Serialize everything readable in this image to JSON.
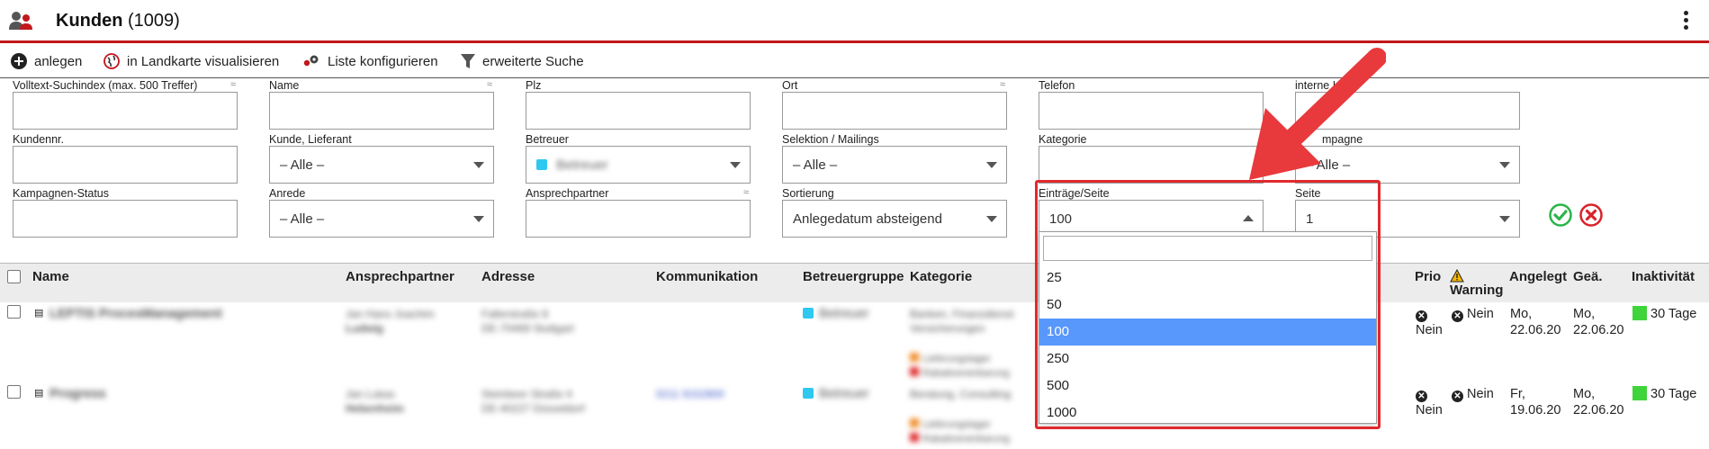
{
  "header": {
    "title": "Kunden",
    "count": "(1009)"
  },
  "toolbar": {
    "add_label": "anlegen",
    "map_label": "in Landkarte visualisieren",
    "config_label": "Liste konfigurieren",
    "search_label": "erweiterte Suche"
  },
  "filters": {
    "fulltext": {
      "label": "Volltext-Suchindex (max. 500 Treffer)",
      "value": ""
    },
    "name": {
      "label": "Name",
      "value": ""
    },
    "plz": {
      "label": "Plz",
      "value": ""
    },
    "ort": {
      "label": "Ort",
      "value": ""
    },
    "telefon": {
      "label": "Telefon",
      "value": ""
    },
    "interne": {
      "label": "interne I",
      "value": ""
    },
    "kundennr": {
      "label": "Kundennr.",
      "value": ""
    },
    "kunde_lieferant": {
      "label": "Kunde, Lieferant",
      "value": "– Alle –"
    },
    "betreuer": {
      "label": "Betreuer",
      "value": "Betreuer"
    },
    "selektion": {
      "label": "Selektion / Mailings",
      "value": "– Alle –"
    },
    "kategorie": {
      "label": "Kategorie",
      "value": ""
    },
    "kampagne": {
      "label": "mpagne",
      "value": "– Alle –"
    },
    "kampagnen_status": {
      "label": "Kampagnen-Status",
      "value": ""
    },
    "anrede": {
      "label": "Anrede",
      "value": "– Alle –"
    },
    "ansprechpartner": {
      "label": "Ansprechpartner",
      "value": ""
    },
    "sortierung": {
      "label": "Sortierung",
      "value": "Anlegedatum absteigend"
    },
    "eintraege": {
      "label": "Einträge/Seite",
      "value": "100"
    },
    "seite": {
      "label": "Seite",
      "value": "1"
    },
    "approx_symbol": "≈"
  },
  "dropdown": {
    "search_value": "",
    "options": [
      "25",
      "50",
      "100",
      "250",
      "500",
      "1000"
    ],
    "selected": "100"
  },
  "table": {
    "columns": {
      "name": "Name",
      "ansprechpartner": "Ansprechpartner",
      "adresse": "Adresse",
      "kommunikation": "Kommunikation",
      "betreuergruppe": "Betreuergruppe",
      "kategorie": "Kategorie",
      "prio": "Prio",
      "warning": "Warning",
      "angelegt": "Angelegt",
      "geae": "Geä.",
      "inaktivitaet": "Inaktivität"
    },
    "rows": [
      {
        "name": "LEPTIS ProcesManagement",
        "ansprechpartner_1": "Jan Hans Joachim",
        "ansprechpartner_2": "Ludwig",
        "adresse_1": "Fallerstraße 8",
        "adresse_2": "DE-70469 Stuttgart",
        "kommunikation": "",
        "betreuer": "Betreuer",
        "kategorie_1": "Banken, Finanzdienst",
        "kategorie_2": "Versicherungen",
        "kategorie_3": "Lieferungslager",
        "kategorie_4": "Rabattvereinbarung",
        "prio_x": "Nein",
        "warning_x": "Nein",
        "angelegt_1": "Mo,",
        "angelegt_2": "22.06.20",
        "geae_1": "Mo,",
        "geae_2": "22.06.20",
        "inaktiv": "30 Tage"
      },
      {
        "name": "Progress",
        "ansprechpartner_1": "Jan Lukas",
        "ansprechpartner_2": "Hebenheim",
        "adresse_1": "Steinbeer Straße 4",
        "adresse_2": "DE-40227 Düsseldorf",
        "kommunikation": "0211 9152800",
        "betreuer": "Betreuer",
        "kategorie_1": "Beratung, Consulting",
        "kategorie_2": "",
        "kategorie_3": "Lieferungslager",
        "kategorie_4": "Rabattvereinbarung",
        "prio_x": "Nein",
        "warning_x": "Nein",
        "angelegt_1": "Fr,",
        "angelegt_2": "19.06.20",
        "geae_1": "Mo,",
        "geae_2": "22.06.20",
        "inaktiv": "30 Tage"
      }
    ]
  },
  "colors": {
    "accent_red": "#c0181b",
    "select_blue": "#5897fb",
    "ok_green": "#2bb44a",
    "cancel_red": "#d9232a",
    "annotation_red": "#e0292e"
  }
}
